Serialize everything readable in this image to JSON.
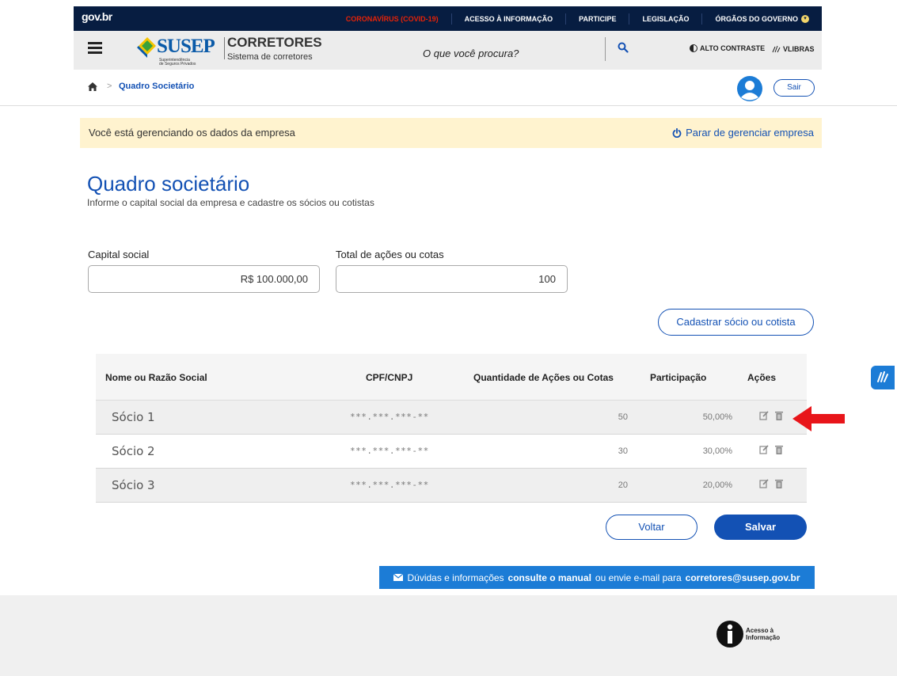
{
  "govbar": {
    "logo": "gov.br",
    "links": [
      "CORONAVÍRUS (COVID-19)",
      "ACESSO À INFORMAÇÃO",
      "PARTICIPE",
      "LEGISLAÇÃO",
      "ÓRGÃOS DO GOVERNO"
    ]
  },
  "header": {
    "brand": "SUSEP",
    "brand_sub1": "Superintendência",
    "brand_sub2": "de Seguros Privados",
    "system_title": "CORRETORES",
    "system_subtitle": "Sistema de corretores",
    "search_placeholder": "O que você procura?",
    "alto_contraste": "ALTO CONTRASTE",
    "vlibras": "VLIBRAS"
  },
  "breadcrumb": {
    "separator": ">",
    "current": "Quadro Societário"
  },
  "user": {
    "logout_label": "Sair"
  },
  "notice": {
    "message": "Você está gerenciando os dados da empresa",
    "action": "Parar de gerenciar empresa"
  },
  "page": {
    "title": "Quadro societário",
    "subtitle": "Informe o capital social da empresa e cadastre os sócios ou cotistas"
  },
  "form": {
    "capital_label": "Capital social",
    "capital_value": "R$ 100.000,00",
    "total_label": "Total de ações ou cotas",
    "total_value": "100",
    "add_button": "Cadastrar sócio ou cotista"
  },
  "table": {
    "headers": [
      "Nome ou Razão Social",
      "CPF/CNPJ",
      "Quantidade de Ações ou Cotas",
      "Participação",
      "Ações"
    ],
    "rows": [
      {
        "name": "Sócio 1",
        "cpf": "***.***.***-**",
        "qtd": "50",
        "part": "50,00%"
      },
      {
        "name": "Sócio 2",
        "cpf": "***.***.***-**",
        "qtd": "30",
        "part": "30,00%"
      },
      {
        "name": "Sócio 3",
        "cpf": "***.***.***-**",
        "qtd": "20",
        "part": "20,00%"
      }
    ]
  },
  "actions": {
    "back": "Voltar",
    "save": "Salvar"
  },
  "help": {
    "t1": "Dúvidas e informações",
    "t2": "consulte o manual",
    "t3": "ou envie e-mail para",
    "t4": "corretores@susep.gov.br"
  },
  "footer": {
    "acesso1": "Acesso à",
    "acesso2": "Informação"
  },
  "colors": {
    "primary": "#1351b4",
    "govbar": "#071d41",
    "notice_bg": "#fff3cf",
    "covid": "#e52207",
    "arrow": "#e8151a"
  }
}
